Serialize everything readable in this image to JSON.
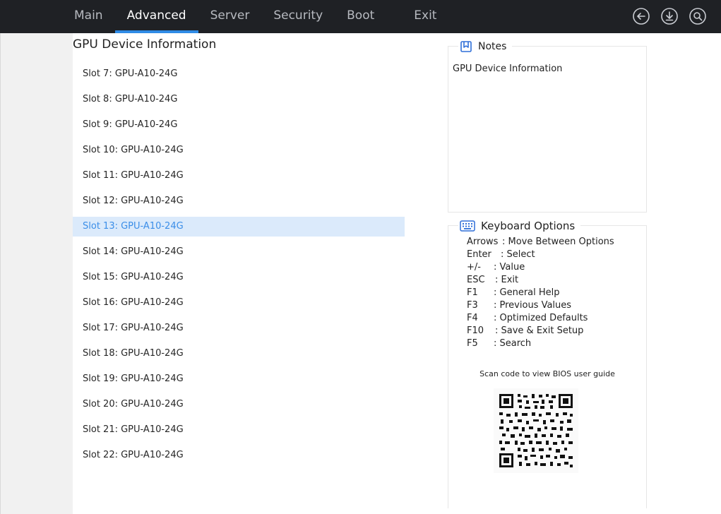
{
  "nav": {
    "tabs": [
      "Main",
      "Advanced",
      "Server",
      "Security",
      "Boot",
      "Exit"
    ],
    "active_index": 1,
    "icons": [
      "back-icon",
      "download-icon",
      "search-icon"
    ]
  },
  "main": {
    "title": "GPU Device Information",
    "items": [
      "Slot 7: GPU-A10-24G",
      "Slot 8: GPU-A10-24G",
      "Slot 9: GPU-A10-24G",
      "Slot 10: GPU-A10-24G",
      "Slot 11: GPU-A10-24G",
      "Slot 12: GPU-A10-24G",
      "Slot 13: GPU-A10-24G",
      "Slot 14: GPU-A10-24G",
      "Slot 15: GPU-A10-24G",
      "Slot 16: GPU-A10-24G",
      "Slot 17: GPU-A10-24G",
      "Slot 18: GPU-A10-24G",
      "Slot 19: GPU-A10-24G",
      "Slot 20: GPU-A10-24G",
      "Slot 21: GPU-A10-24G",
      "Slot 22: GPU-A10-24G"
    ],
    "selected_index": 6
  },
  "notes": {
    "title": "Notes",
    "text": "GPU Device Information"
  },
  "keyboard": {
    "title": "Keyboard Options",
    "rows": [
      {
        "key": "Arrows",
        "desc": ": Move Between Options"
      },
      {
        "key": "Enter",
        "desc": ": Select"
      },
      {
        "key": "+/-",
        "desc": ": Value"
      },
      {
        "key": "ESC",
        "desc": ": Exit"
      },
      {
        "key": "F1",
        "desc": ": General Help"
      },
      {
        "key": "F3",
        "desc": ": Previous Values"
      },
      {
        "key": "F4",
        "desc": ": Optimized Defaults"
      },
      {
        "key": "F10",
        "desc": ": Save & Exit Setup"
      },
      {
        "key": "F5",
        "desc": ": Search"
      }
    ],
    "scan_text": "Scan code to view BIOS user guide"
  },
  "colors": {
    "topbar": "#1f2125",
    "accent": "#2f8be6",
    "selected_bg": "#dbeafb",
    "selected_text": "#3b8ee8"
  }
}
